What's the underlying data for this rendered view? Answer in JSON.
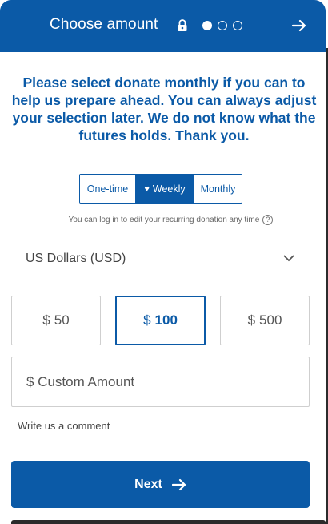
{
  "header": {
    "title": "Choose amount",
    "icons": [
      "lock-icon",
      "step-dot-filled",
      "step-dot-empty",
      "step-dot-empty",
      "arrow-right-icon"
    ],
    "current_step": 1,
    "total_steps": 3
  },
  "message": "Please select donate monthly if you can to help us prepare ahead. You can always adjust your selection later. We do not know what the futures holds. Thank you.",
  "frequency": {
    "one_time": "One-time",
    "weekly": "Weekly",
    "monthly": "Monthly",
    "selected": "Weekly"
  },
  "login_note": "You can log in to edit your recurring donation any time",
  "help_glyph": "?",
  "currency": {
    "selected": "US Dollars (USD)"
  },
  "amounts": [
    {
      "symbol": "$",
      "value": "50"
    },
    {
      "symbol": "$",
      "value": "100"
    },
    {
      "symbol": "$",
      "value": "500"
    }
  ],
  "selected_amount": "100",
  "custom_amount_placeholder": "$ Custom Amount",
  "comment_link": "Write us a comment",
  "next_button": "Next",
  "colors": {
    "primary": "#0b5aa7",
    "border": "#cfcfcf"
  }
}
